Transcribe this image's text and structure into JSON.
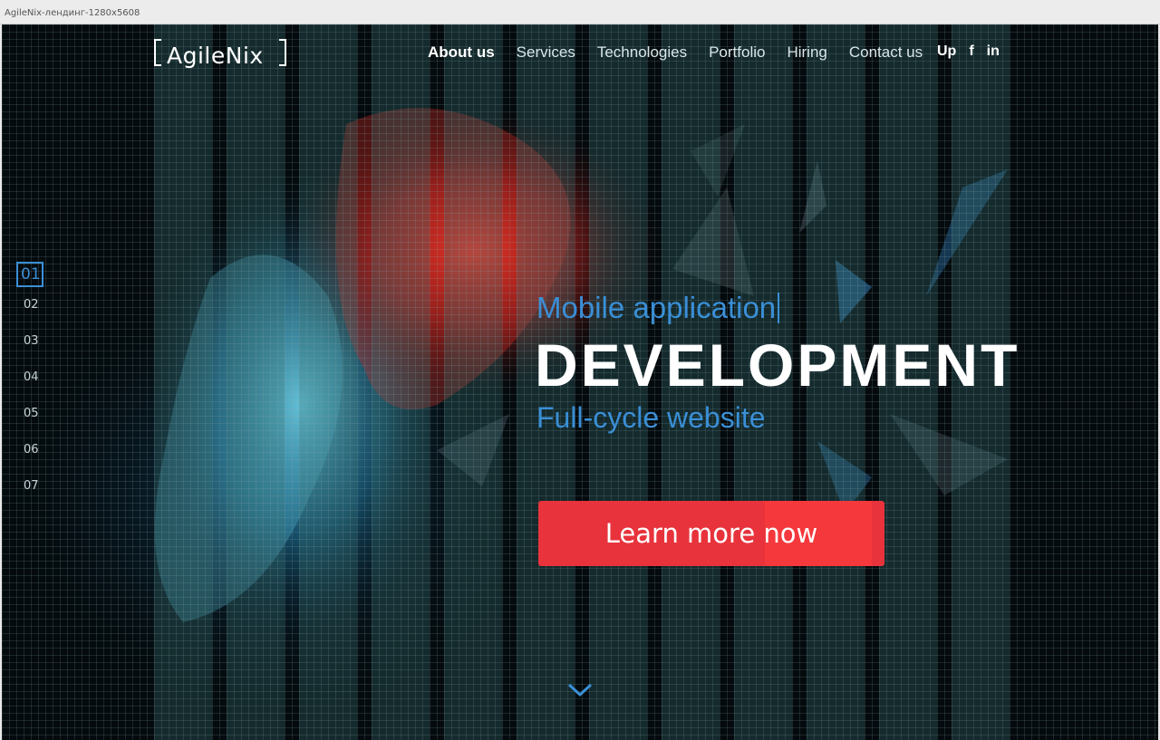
{
  "window": {
    "title": "AgileNix-лендинг-1280x5608"
  },
  "header": {
    "logo_text": "AgileNix",
    "nav": [
      {
        "label": "About us",
        "active": true
      },
      {
        "label": "Services",
        "active": false
      },
      {
        "label": "Technologies",
        "active": false
      },
      {
        "label": "Portfolio",
        "active": false
      },
      {
        "label": "Hiring",
        "active": false
      },
      {
        "label": "Contact us",
        "active": false
      }
    ],
    "social": [
      {
        "icon": "upwork-icon",
        "label": "Up"
      },
      {
        "icon": "facebook-icon",
        "label": "f"
      },
      {
        "icon": "linkedin-icon",
        "label": "in"
      }
    ]
  },
  "slide_nav": {
    "items": [
      "01",
      "02",
      "03",
      "04",
      "05",
      "06",
      "07"
    ],
    "active_index": 0
  },
  "hero": {
    "subtitle": "Mobile application",
    "title": "DEVELOPMENT",
    "subtitle2": "Full-cycle website",
    "cta_label": "Learn more now"
  },
  "colors": {
    "accent_blue": "#3a8fd6",
    "cta_red": "#e8333c",
    "background": "#040a0d"
  },
  "icons": {
    "scroll_down": "chevron-down-icon"
  }
}
